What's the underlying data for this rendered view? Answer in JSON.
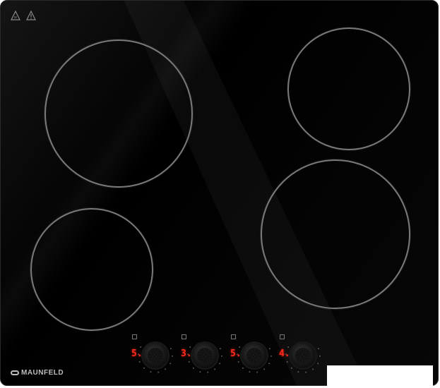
{
  "brand": {
    "name": "MAUNFELD",
    "logo_icon": "maunfeld-logo-icon"
  },
  "warning_icons": [
    "hot-surface-warning-icon",
    "caution-warning-icon"
  ],
  "cooking_zones": [
    {
      "name": "rear-left",
      "shape": "circle"
    },
    {
      "name": "rear-right",
      "shape": "circle"
    },
    {
      "name": "front-left",
      "shape": "circle"
    },
    {
      "name": "front-right",
      "shape": "circle"
    }
  ],
  "controls": [
    {
      "display": "5.",
      "knob": "rear-left"
    },
    {
      "display": "3.",
      "knob": "front-left"
    },
    {
      "display": "5.",
      "knob": "front-right"
    },
    {
      "display": "4.",
      "knob": "rear-right"
    }
  ],
  "colors": {
    "glass": "#000000",
    "zone_outline": "#7a7a7a",
    "display": "#ff2a1a",
    "brand_text": "#bdbdbd"
  }
}
